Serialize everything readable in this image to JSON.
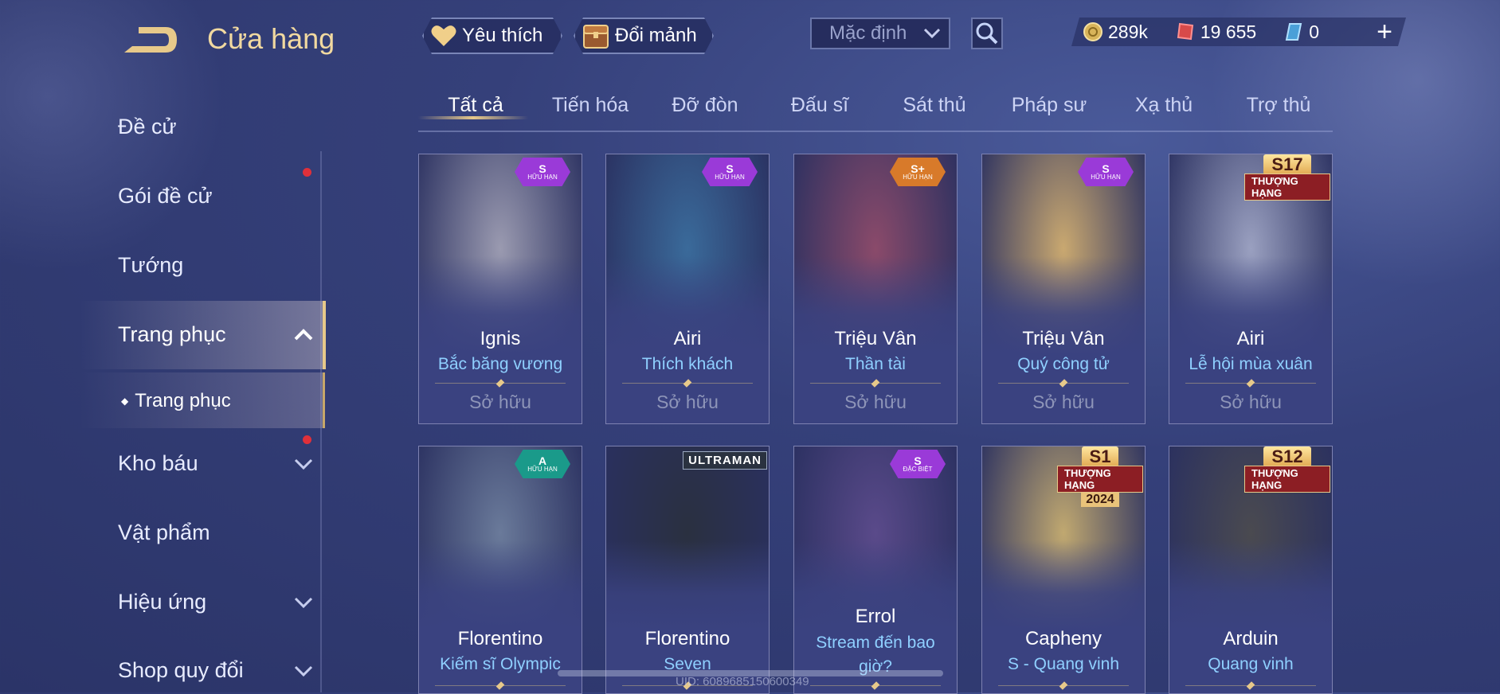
{
  "header": {
    "title": "Cửa hàng",
    "favorite_label": "Yêu thích",
    "exchange_label": "Đổi mảnh",
    "sort_value": "Mặc định",
    "currency": {
      "gold": "289k",
      "vouchers": "19 655",
      "gems": "0"
    },
    "plus_label": "+"
  },
  "sidebar": {
    "items": [
      {
        "label": "Đề cử"
      },
      {
        "label": "Gói đề cử"
      },
      {
        "label": "Tướng"
      },
      {
        "label": "Trang phục"
      },
      {
        "label": "Trang phục"
      },
      {
        "label": "Kho báu"
      },
      {
        "label": "Vật phẩm"
      },
      {
        "label": "Hiệu ứng"
      },
      {
        "label": "Shop quy đổi"
      }
    ]
  },
  "tabs": [
    "Tất cả",
    "Tiến hóa",
    "Đỡ đòn",
    "Đấu sĩ",
    "Sát thủ",
    "Pháp sư",
    "Xạ thủ",
    "Trợ thủ"
  ],
  "cards": [
    {
      "name": "Ignis",
      "skin": "Bắc băng vương",
      "owned": "Sở hữu",
      "badge_grade": "S",
      "badge_sub": "HỮU HẠN",
      "color": "#9a9ab0"
    },
    {
      "name": "Airi",
      "skin": "Thích khách",
      "owned": "Sở hữu",
      "badge_grade": "S",
      "badge_sub": "HỮU HẠN",
      "color": "#3a6a9a"
    },
    {
      "name": "Triệu Vân",
      "skin": "Thần tài",
      "owned": "Sở hữu",
      "badge_grade": "S+",
      "badge_sub": "HỮU HẠN",
      "color": "#8a4a6a"
    },
    {
      "name": "Triệu Vân",
      "skin": "Quý công tử",
      "owned": "Sở hữu",
      "badge_grade": "S",
      "badge_sub": "HỮU HẠN",
      "color": "#c9a870"
    },
    {
      "name": "Airi",
      "skin": "Lễ hội mùa xuân",
      "owned": "Sở hữu",
      "season": "S17",
      "rank": "THƯỢNG HẠNG",
      "color": "#9aa0c0"
    },
    {
      "name": "Florentino",
      "skin": "Kiếm sĩ Olympic",
      "badge_grade": "A",
      "badge_sub": "HỮU HẠN",
      "color": "#6a7a9a"
    },
    {
      "name": "Florentino",
      "skin": "Seven",
      "ultra": "ULTRAMAN",
      "color": "#2a3040"
    },
    {
      "name": "Errol",
      "skin": "Stream đến bao giờ?",
      "badge_grade": "S",
      "badge_sub": "ĐẶC BIỆT",
      "color": "#5a4a8a"
    },
    {
      "name": "Capheny",
      "skin": "S - Quang vinh",
      "season": "S1",
      "rank": "THƯỢNG HẠNG",
      "year": "2024",
      "color": "#c0a870"
    },
    {
      "name": "Arduin",
      "skin": "Quang vinh",
      "season": "S12",
      "rank": "THƯỢNG HẠNG",
      "color": "#4a4a50"
    }
  ],
  "footer": {
    "uid": "UID: 6089685150600349"
  }
}
